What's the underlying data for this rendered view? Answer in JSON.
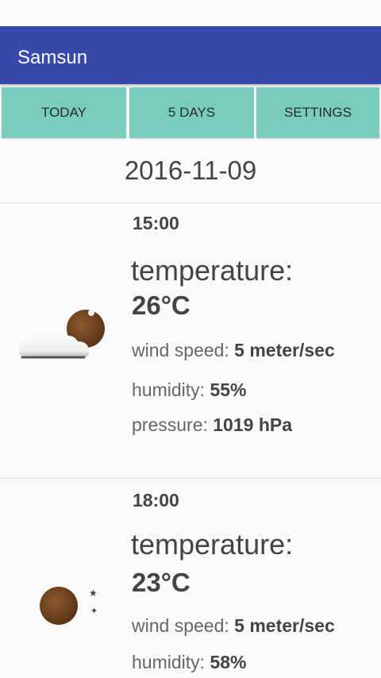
{
  "app": {
    "title": "Samsun"
  },
  "tabs": [
    {
      "label": "TODAY"
    },
    {
      "label": "5 DAYS"
    },
    {
      "label": "SETTINGS"
    }
  ],
  "date": "2016-11-09",
  "forecasts": [
    {
      "time": "15:00",
      "icon": "cloudy-night-icon",
      "temperature_label": "temperature:",
      "temperature": "26°C",
      "wind_label": "wind speed: ",
      "wind": "5 meter/sec",
      "humidity_label": "humidity: ",
      "humidity": "55%",
      "pressure_label": "pressure: ",
      "pressure": "1019 hPa"
    },
    {
      "time": "18:00",
      "icon": "clear-night-icon",
      "temperature_label": "temperature:",
      "temperature": "23°C",
      "wind_label": "wind speed: ",
      "wind": "5 meter/sec",
      "humidity_label": "humidity: ",
      "humidity": "58%"
    }
  ],
  "colors": {
    "app_bar": "#3949ab",
    "tab_background": "#78cdbe",
    "moon": "#7a4a25"
  }
}
